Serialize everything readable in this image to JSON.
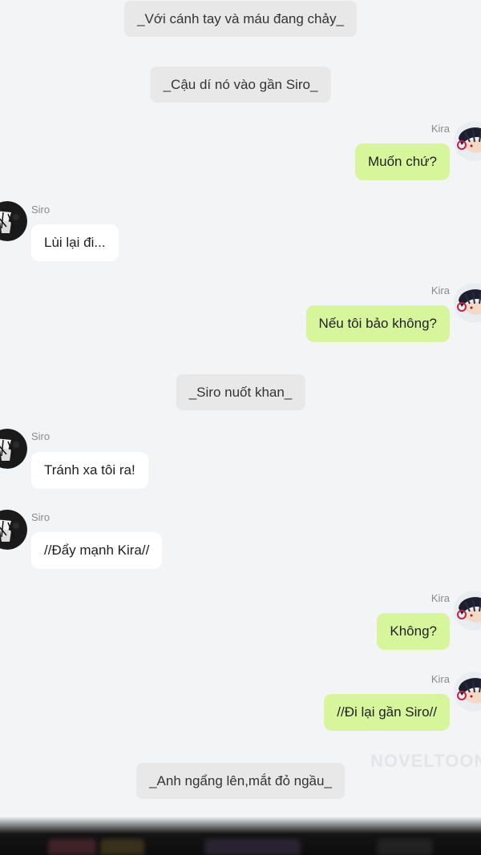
{
  "watermark": "NOVELTOON",
  "messages": [
    {
      "type": "narration",
      "text": "_Với cánh tay và máu đang chảy_"
    },
    {
      "type": "narration",
      "text": "_Cậu dí nó vào gần Siro_"
    },
    {
      "type": "right",
      "sender": "Kira",
      "text": "Muốn chứ?"
    },
    {
      "type": "left",
      "sender": "Siro",
      "text": "Lùi lại đi..."
    },
    {
      "type": "right",
      "sender": "Kira",
      "text": "Nếu tôi bảo không?"
    },
    {
      "type": "narration",
      "text": "_Siro nuốt khan_"
    },
    {
      "type": "left",
      "sender": "Siro",
      "text": "Tránh xa tôi ra!"
    },
    {
      "type": "left",
      "sender": "Siro",
      "text": "//Đẩy mạnh Kira//"
    },
    {
      "type": "right",
      "sender": "Kira",
      "text": "Không?"
    },
    {
      "type": "right",
      "sender": "Kira",
      "text": "//Đi lại gần Siro//"
    },
    {
      "type": "narration",
      "text": "_Anh ngẩng lên,mắt đỏ ngầu_"
    }
  ],
  "colors": {
    "background": "#f3f4f6",
    "kira_bubble": "#d7f59b",
    "siro_bubble": "#ffffff",
    "narration_bubble": "#e8e8e9"
  },
  "avatars": {
    "kira": "kira-avatar-icon",
    "siro": "siro-avatar-icon"
  }
}
